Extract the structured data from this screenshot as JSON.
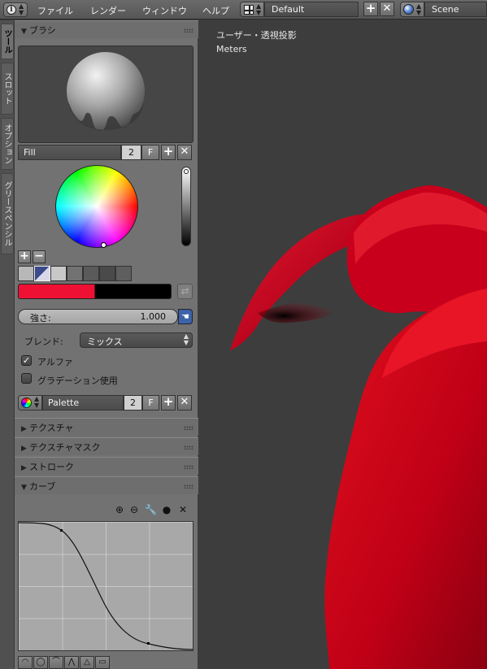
{
  "menubar": {
    "menus": [
      "ファイル",
      "レンダー",
      "ウィンドウ",
      "ヘルプ"
    ],
    "screen_layout": "Default",
    "scene": "Scene"
  },
  "vertical_tabs": [
    "ツール",
    "スロット",
    "オプション",
    "グリースペンシル"
  ],
  "panel": {
    "brush_header": "ブラシ",
    "brush": {
      "name": "Fill",
      "users": "2",
      "fake_user": "F"
    },
    "color": {
      "primary": "#ee1133",
      "secondary": "#000000"
    },
    "strength": {
      "label": "強さ:",
      "value": "1.000"
    },
    "blend": {
      "label": "ブレンド:",
      "value": "ミックス"
    },
    "alpha_label": "アルファ",
    "gradient_label": "グラデーション使用",
    "palette": {
      "name": "Palette",
      "users": "2",
      "fake_user": "F"
    },
    "sections": [
      "テクスチャ",
      "テクスチャマスク",
      "ストローク",
      "カーブ"
    ]
  },
  "viewport": {
    "view_label": "ユーザー・透視投影",
    "units": "Meters",
    "mesh_color": "#cc0022"
  }
}
